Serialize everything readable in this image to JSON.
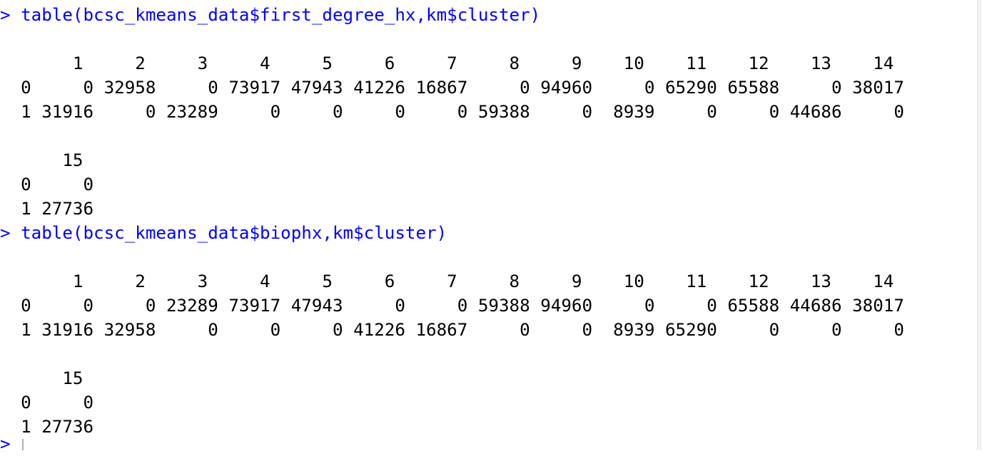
{
  "console": {
    "lines": [
      {
        "kind": "cmd",
        "prompt": ">",
        "text": " table(bcsc_kmeans_data$first_degree_hx,km$cluster)"
      },
      {
        "kind": "out",
        "text": ""
      },
      {
        "kind": "out",
        "text": "       1     2     3     4     5     6     7     8     9    10    11    12    13    14"
      },
      {
        "kind": "out",
        "text": "  0     0 32958     0 73917 47943 41226 16867     0 94960     0 65290 65588     0 38017"
      },
      {
        "kind": "out",
        "text": "  1 31916     0 23289     0     0     0     0 59388     0  8939     0     0 44686     0"
      },
      {
        "kind": "out",
        "text": ""
      },
      {
        "kind": "out",
        "text": "      15"
      },
      {
        "kind": "out",
        "text": "  0     0"
      },
      {
        "kind": "out",
        "text": "  1 27736"
      },
      {
        "kind": "cmd",
        "prompt": ">",
        "text": " table(bcsc_kmeans_data$biophx,km$cluster)"
      },
      {
        "kind": "out",
        "text": ""
      },
      {
        "kind": "out",
        "text": "       1     2     3     4     5     6     7     8     9    10    11    12    13    14"
      },
      {
        "kind": "out",
        "text": "  0     0     0 23289 73917 47943     0     0 59388 94960     0     0 65588 44686 38017"
      },
      {
        "kind": "out",
        "text": "  1 31916 32958     0     0     0 41226 16867     0     0  8939 65290     0     0     0"
      },
      {
        "kind": "out",
        "text": ""
      },
      {
        "kind": "out",
        "text": "      15"
      },
      {
        "kind": "out",
        "text": "  0     0"
      },
      {
        "kind": "out",
        "text": "  1 27736"
      }
    ],
    "cursor_prompt": ">"
  },
  "colors": {
    "command": "#0000ff",
    "output": "#000000",
    "background": "#ffffff"
  }
}
